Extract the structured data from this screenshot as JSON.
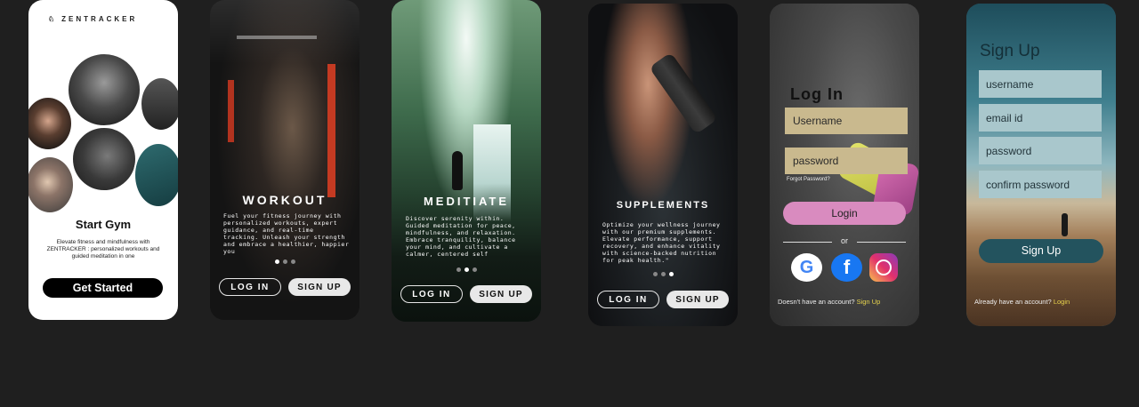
{
  "screen1": {
    "brand": "ZENTRACKER",
    "title": "Start Gym",
    "description": "Elevate fitness and mindfulness with ZENTRACKER : personalized workouts and guided meditation in one",
    "cta": "Get Started"
  },
  "screen2": {
    "heading": "WORKOUT",
    "body": "Fuel your fitness journey with personalized workouts, expert guidance, and real-time tracking. Unleash your strength and embrace a healthier, happier you",
    "login": "LOG IN",
    "signup": "SIGN UP"
  },
  "screen3": {
    "heading": "MEDITIATE",
    "body": "Discover serenity within. Guided meditation for peace, mindfulness, and relaxation. Embrace tranquility, balance your mind, and cultivate a calmer, centered self",
    "login": "LOG IN",
    "signup": "SIGN UP"
  },
  "screen4": {
    "heading": "SUPPLEMENTS",
    "body": "Optimize your wellness journey with our premium supplements. Elevate performance, support recovery, and enhance vitality with science-backed nutrition for peak health.\"",
    "login": "LOG IN",
    "signup": "SIGN UP"
  },
  "screen5": {
    "title": "Log In",
    "username": "Username",
    "password": "password",
    "forgot": "Forgot Password?",
    "login": "Login",
    "or": "or",
    "no_account": "Doesn't have an account?",
    "signup_link": "Sign Up"
  },
  "screen6": {
    "title": "Sign Up",
    "username": "username",
    "email": "email id",
    "password": "password",
    "confirm": "confirm password",
    "signup": "Sign Up",
    "have_account": "Already have an account?",
    "login_link": "Login"
  },
  "colors": {
    "background": "#1f1f1f",
    "login_pink": "#d98bbf",
    "field_tan": "#c9b98e",
    "field_teal": "#a9c7cc",
    "link_yellow": "#e8d44d"
  }
}
